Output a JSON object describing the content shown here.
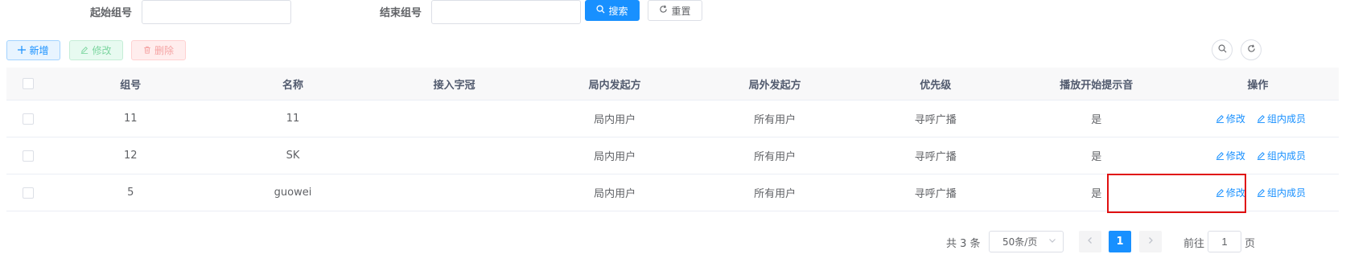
{
  "search": {
    "start_label": "起始组号",
    "end_label": "结束组号",
    "start_value": "",
    "end_value": "",
    "search_button": "搜索",
    "reset_button": "重置"
  },
  "toolbar": {
    "add": "新增",
    "edit": "修改",
    "delete": "删除"
  },
  "table": {
    "headers": [
      "组号",
      "名称",
      "接入字冠",
      "局内发起方",
      "局外发起方",
      "优先级",
      "播放开始提示音",
      "操作"
    ],
    "rows": [
      {
        "group": "11",
        "name": "11",
        "prefix": "",
        "inside": "局内用户",
        "outside": "所有用户",
        "priority": "寻呼广播",
        "tone": "是",
        "op_edit": "修改",
        "op_members": "组内成员"
      },
      {
        "group": "12",
        "name": "SK",
        "prefix": "",
        "inside": "局内用户",
        "outside": "所有用户",
        "priority": "寻呼广播",
        "tone": "是",
        "op_edit": "修改",
        "op_members": "组内成员"
      },
      {
        "group": "5",
        "name": "guowei",
        "prefix": "",
        "inside": "局内用户",
        "outside": "所有用户",
        "priority": "寻呼广播",
        "tone": "是",
        "op_edit": "修改",
        "op_members": "组内成员"
      }
    ]
  },
  "pagination": {
    "total": "共 3 条",
    "page_size": "50条/页",
    "current_page": "1",
    "goto_prefix": "前往",
    "goto_value": "1",
    "goto_suffix": "页"
  },
  "colors": {
    "primary": "#1890ff",
    "highlight_box": "#e01010"
  }
}
